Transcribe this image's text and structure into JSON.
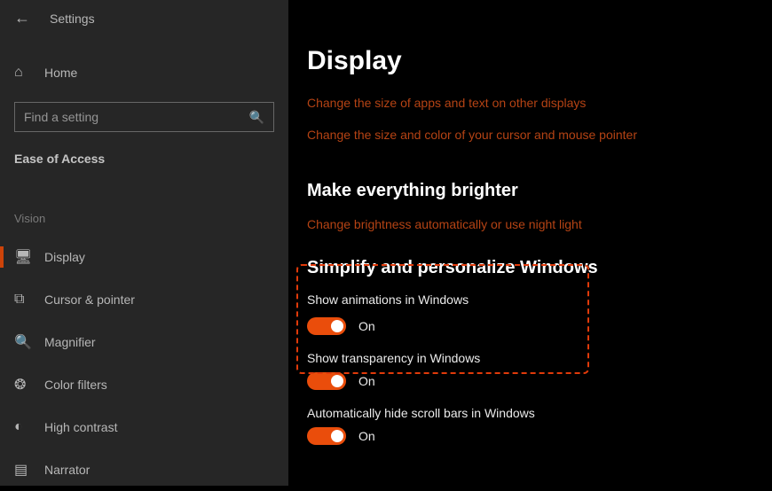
{
  "window": {
    "title": "Settings"
  },
  "sidebar": {
    "home": "Home",
    "search_placeholder": "Find a setting",
    "category": "Ease of Access",
    "subcategory": "Vision",
    "items": [
      {
        "icon": "display",
        "label": "Display",
        "selected": true
      },
      {
        "icon": "cursor",
        "label": "Cursor & pointer"
      },
      {
        "icon": "magnify",
        "label": "Magnifier"
      },
      {
        "icon": "filters",
        "label": "Color filters"
      },
      {
        "icon": "contrast",
        "label": "High contrast"
      },
      {
        "icon": "narrator",
        "label": "Narrator"
      }
    ]
  },
  "content": {
    "heading": "Display",
    "link_size": "Change the size of apps and text on other displays",
    "link_cursor": "Change the size and color of your cursor and mouse pointer",
    "brightness_heading": "Make everything brighter",
    "brightness_link": "Change brightness automatically or use night light",
    "simplify": {
      "heading": "Simplify and personalize Windows",
      "animations_label": "Show animations in Windows",
      "animations_state": "On",
      "transparency_label": "Show transparency in Windows",
      "transparency_state": "On",
      "scrollbars_label": "Automatically hide scroll bars in Windows",
      "scrollbars_state": "On"
    }
  },
  "colors": {
    "accent": "#ea4d0b",
    "link": "#b54314"
  }
}
